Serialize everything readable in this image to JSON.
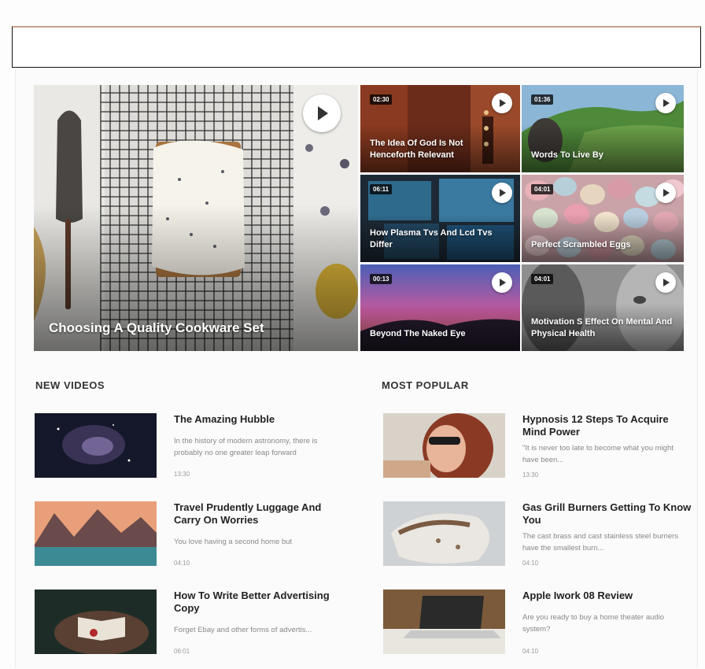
{
  "top_bar": {},
  "hero": {
    "title": "Choosing A Quality Cookware Set"
  },
  "grid_tiles": [
    {
      "title": "The Idea Of God Is Not Henceforth Relevant",
      "duration": "02:30"
    },
    {
      "title": "Words To Live By",
      "duration": "01:36"
    },
    {
      "title": "How Plasma Tvs And Lcd Tvs Differ",
      "duration": "06:11"
    },
    {
      "title": "Perfect Scrambled Eggs",
      "duration": "04:01"
    },
    {
      "title": "Beyond The Naked Eye",
      "duration": "00:13"
    },
    {
      "title": "Motivation S Effect On Mental And Physical Health",
      "duration": "04:01"
    }
  ],
  "new_videos": {
    "heading": "NEW VIDEOS",
    "items": [
      {
        "title": "The Amazing Hubble",
        "excerpt": "In the history of modern astronomy, there is probably no one greater leap forward",
        "time": "13:30"
      },
      {
        "title": "Travel Prudently Luggage And Carry On Worries",
        "excerpt": "You love having a second home but",
        "time": "04:10"
      },
      {
        "title": "How To Write Better Advertising Copy",
        "excerpt": "Forget Ebay and other forms of advertis...",
        "time": "06:01"
      }
    ]
  },
  "most_popular": {
    "heading": "MOST POPULAR",
    "items": [
      {
        "title": "Hypnosis 12 Steps To Acquire Mind Power",
        "excerpt": "\"It is never too late to become what you might have been...",
        "time": "13:30"
      },
      {
        "title": "Gas Grill Burners Getting To Know You",
        "excerpt": "The cast brass and cast stainless steel burners have the smallest burn...",
        "time": "04:10"
      },
      {
        "title": "Apple Iwork 08 Review",
        "excerpt": "Are you ready to buy a home theater audio system?",
        "time": "04:10"
      }
    ]
  }
}
